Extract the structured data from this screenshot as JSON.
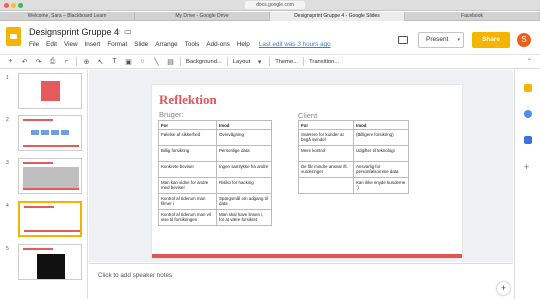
{
  "browser": {
    "url": "docs.google.com",
    "tabs": [
      {
        "label": "Welcome, Sara – Blackboard Learn",
        "active": false
      },
      {
        "label": "My Drive - Google Drive",
        "active": false
      },
      {
        "label": "Designsprint Gruppe 4 - Google Slides",
        "active": true
      },
      {
        "label": "Facebook",
        "active": false
      }
    ]
  },
  "app": {
    "title": "Designsprint Gruppe 4",
    "menu": [
      "File",
      "Edit",
      "View",
      "Insert",
      "Format",
      "Slide",
      "Arrange",
      "Tools",
      "Add-ons",
      "Help"
    ],
    "last_edit": "Last edit was 3 hours ago",
    "present_label": "Present",
    "share_label": "Share",
    "avatar_letter": "S",
    "accent_color": "#f4b400"
  },
  "toolbar": {
    "background": "Background...",
    "layout": "Layout",
    "theme": "Theme...",
    "transition": "Transition..."
  },
  "filmstrip": {
    "slides": [
      {
        "number": "1"
      },
      {
        "number": "2"
      },
      {
        "number": "3"
      },
      {
        "number": "4"
      },
      {
        "number": "5"
      }
    ],
    "active_slide": "4"
  },
  "slide": {
    "title": "Reflektion",
    "heading_left": "Bruger:",
    "heading_right": "Client",
    "accent_color": "#e05656",
    "left_table": {
      "headers": [
        "For",
        "Imod"
      ],
      "rows": [
        [
          "Følelse af sikkerhed",
          "Overvågning"
        ],
        [
          "Billig forsikring",
          "Personlige data"
        ],
        [
          "Konkrete beviser",
          "Ingen samlykke fra andre"
        ],
        [
          "Man kan vidne for andre med beviser",
          "Risiko for hacking"
        ],
        [
          "Kontrol af tiderum man filmer i",
          "Spørgsmål om adgang til data"
        ],
        [
          "Kontrol af tiderum man vil vise til forsikringen",
          "Man skal have linsen i, for at være forsikret"
        ]
      ]
    },
    "right_table": {
      "headers": [
        "For",
        "Imod"
      ],
      "rows": [
        [
          "Sværere for kunder at begå svindel",
          "(Billigere forsikring)"
        ],
        [
          "Mere kontrol",
          "Udgifter til teknologi"
        ],
        [
          "De får mindre ansvar ift. vurderinger",
          "Ansvarlig for personfølsomme data"
        ],
        [
          "",
          "Kan ikke snyde kunderne :)"
        ]
      ]
    }
  },
  "notes": {
    "placeholder": "Click to add speaker notes"
  }
}
